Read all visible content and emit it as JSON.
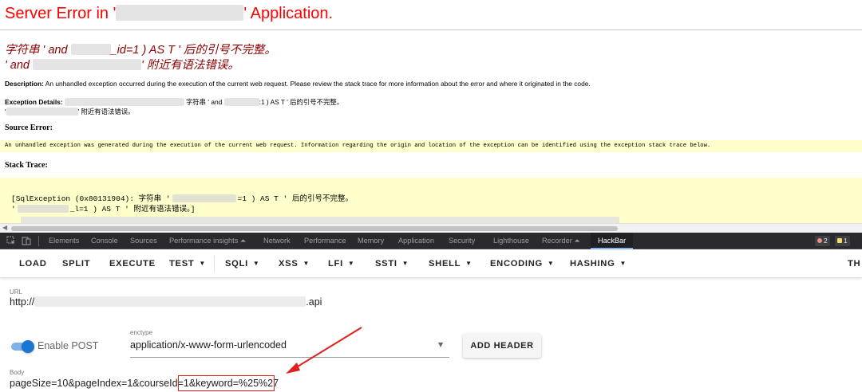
{
  "error_page": {
    "title_prefix": "Server Error in '",
    "title_suffix": "' Application.",
    "sub1_a": "字符串 ' and ",
    "sub1_b": "_id=1 ) AS T ' 后的引号不完整。",
    "sub2_a": "' and ",
    "sub2_b": "' 附近有语法错误。",
    "description_label": "Description:",
    "description_text": "An unhandled exception occurred during the execution of the current web request. Please review the stack trace for more information about the error and where it originated in the code.",
    "exception_label": "Exception Details:",
    "exception_a": "字符串 ' and ",
    "exception_b": ":1 ) AS T ' 后的引号不完整。",
    "exception_line2_a": "'",
    "exception_line2_b": "' 附近有语法错误。",
    "source_error_label": "Source Error:",
    "source_error_text": "An unhandled exception was generated during the execution of the current web request. Information regarding the origin and location of the exception can be identified using the exception stack trace below.",
    "stack_trace_label": "Stack Trace:",
    "stack_line1_a": "[SqlException (0x80131904): 字符串 '",
    "stack_line1_b": "=1 ) AS T ' 后的引号不完整。",
    "stack_line2_a": "'",
    "stack_line2_b": "_l=1 ) AS T ' 附近有语法错误。]"
  },
  "devtools": {
    "tabs": [
      "Elements",
      "Console",
      "Sources",
      "Performance insights ⏶",
      "Network",
      "Performance",
      "Memory",
      "Application",
      "Security",
      "Lighthouse",
      "Recorder ⏶",
      "HackBar"
    ],
    "active_tab": "HackBar",
    "error_count": "2",
    "warning_count": "1",
    "error_color": "#f28b82",
    "warning_color": "#fdd663"
  },
  "hackbar": {
    "buttons": [
      "LOAD",
      "SPLIT",
      "EXECUTE",
      "TEST",
      "SQLI",
      "XSS",
      "LFI",
      "SSTI",
      "SHELL",
      "ENCODING",
      "HASHING",
      "TH"
    ],
    "url_label": "URL",
    "url_prefix": "http://",
    "url_suffix": ".api",
    "enable_post_label": "Enable POST",
    "enable_post": true,
    "enctype_label": "enctype",
    "enctype_value": "application/x-www-form-urlencoded",
    "add_header_label": "ADD HEADER",
    "body_label": "Body",
    "body_value": "pageSize=10&pageIndex=1&courseId=1&keyword=%25%27",
    "accent_color": "#1976d2",
    "highlight_color": "#e0201c"
  },
  "icons": [
    "inspect-icon",
    "device-toggle-icon",
    "dropdown-caret-icon",
    "arrow-icon"
  ]
}
